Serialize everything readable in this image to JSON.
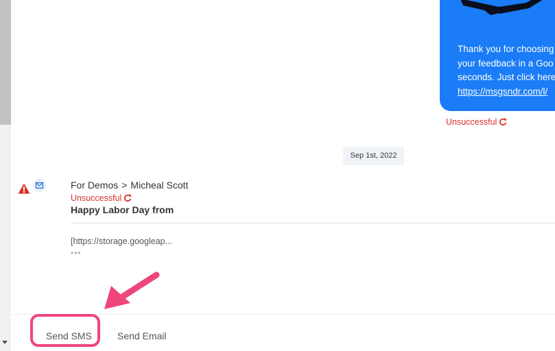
{
  "bubble": {
    "lines": [
      "Thank you for choosing",
      "your feedback in a Goo",
      "seconds. Just click here"
    ],
    "link": "https://msgsndr.com/l/",
    "status": "Unsuccessful"
  },
  "date_chip": "Sep 1st, 2022",
  "message": {
    "sender_group": "For Demos",
    "separator": ">",
    "contact": "Micheal Scott",
    "status": "Unsuccessful",
    "title": "Happy Labor Day from",
    "preview": "[https://storage.googleap...",
    "more": "•••"
  },
  "tabs": {
    "sms": "Send SMS",
    "email": "Send Email"
  },
  "colors": {
    "bubble": "#1a7cf6",
    "error": "#d9332c",
    "highlight": "#f0457a"
  },
  "icons": [
    "plane-icon",
    "retry-icon",
    "warning-icon",
    "mail-icon",
    "arrow-pointer"
  ]
}
